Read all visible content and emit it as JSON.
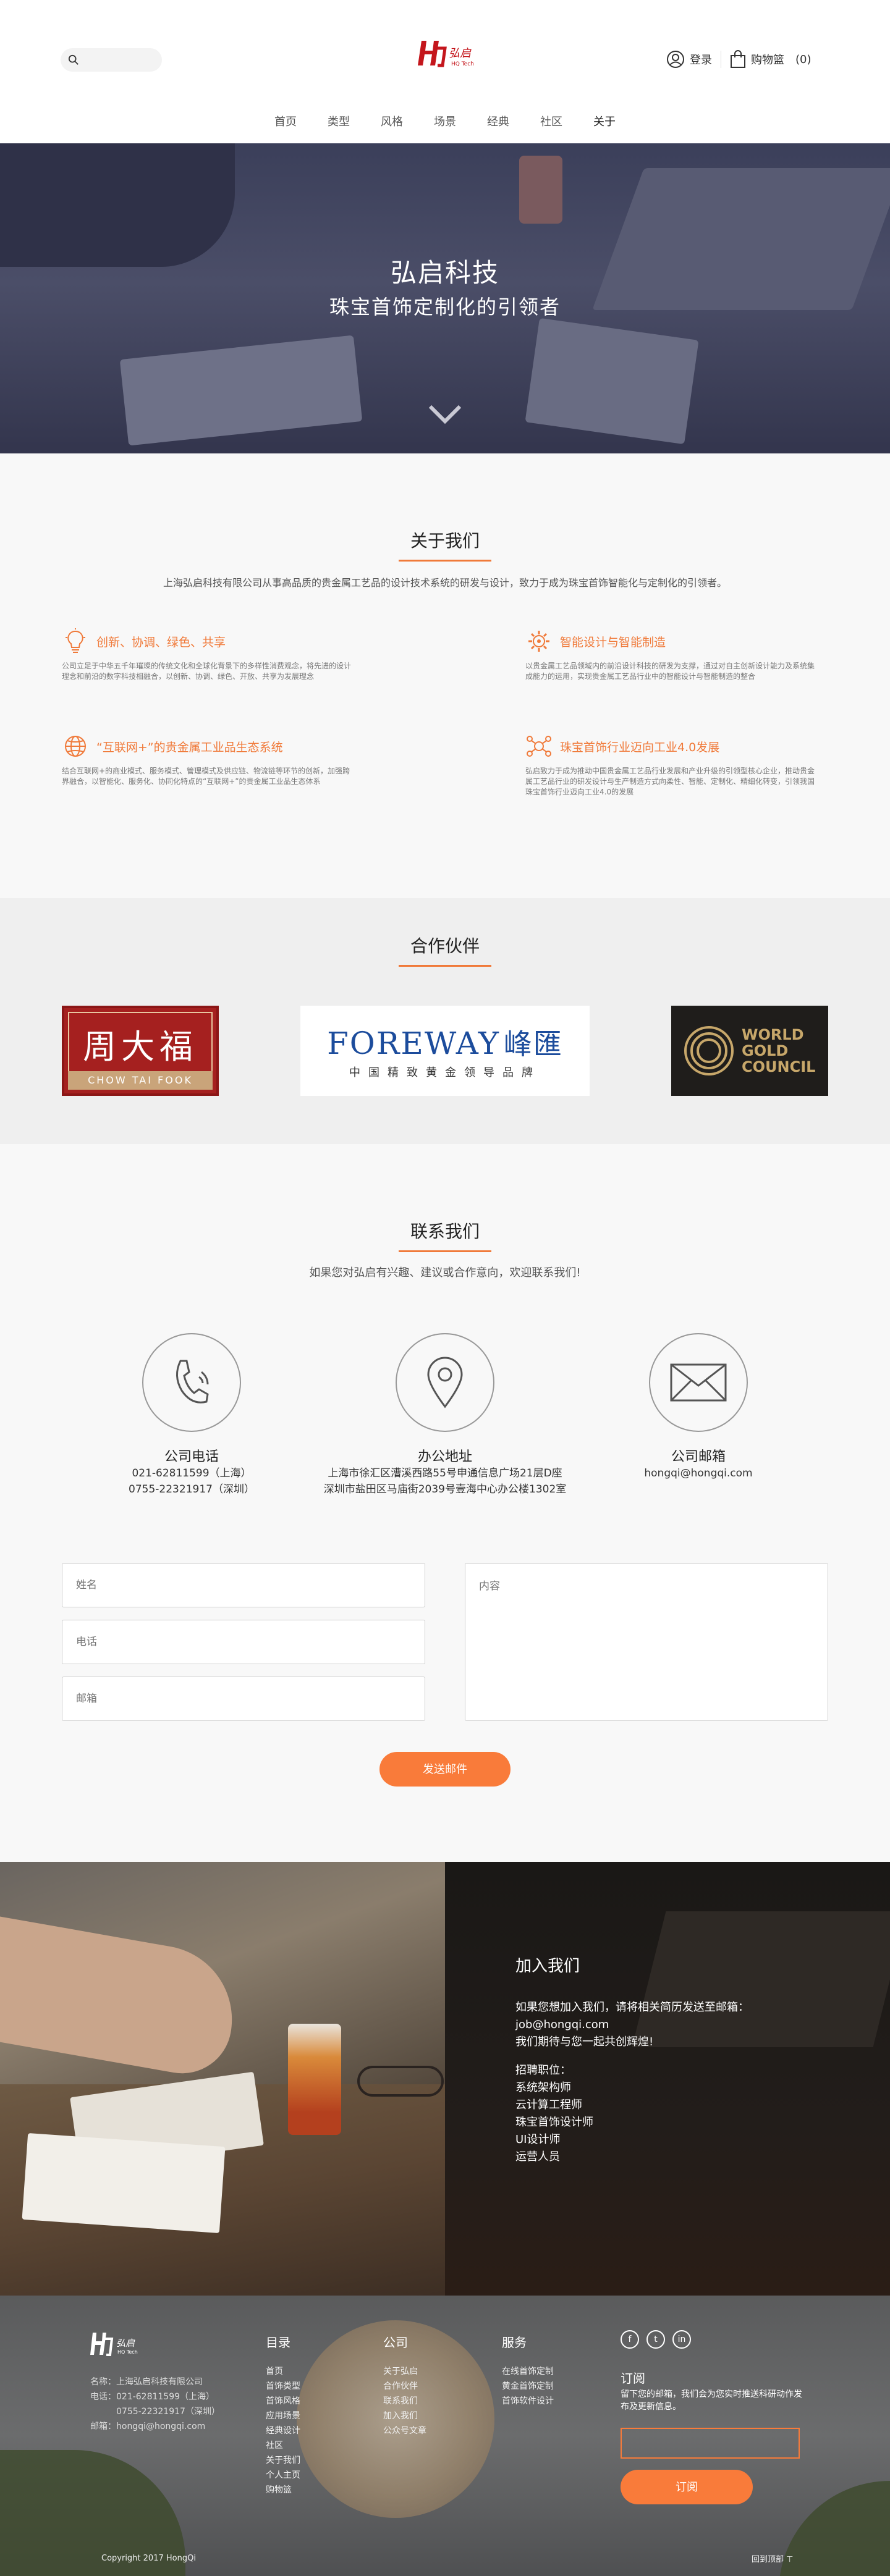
{
  "header": {
    "search_placeholder": "",
    "logo_text": "弘启",
    "logo_sub": "HQ Tech",
    "login_label": "登录",
    "cart_label": "购物篮",
    "cart_count": "(0)"
  },
  "nav": [
    "首页",
    "类型",
    "风格",
    "场景",
    "经典",
    "社区",
    "关于"
  ],
  "nav_active": "关于",
  "hero": {
    "title": "弘启科技",
    "subtitle": "珠宝首饰定制化的引领者"
  },
  "about": {
    "title": "关于我们",
    "desc": "上海弘启科技有限公司从事高品质的贵金属工艺品的设计技术系统的研发与设计，致力于成为珠宝首饰智能化与定制化的引领者。",
    "features": [
      {
        "icon": "lightbulb-icon",
        "title": "创新、协调、绿色、共享",
        "text": "公司立足于中华五千年璀璨的传统文化和全球化背景下的多样性消费观念，将先进的设计理念和前沿的数字科技相融合，以创新、协调、绿色、开放、共享为发展理念"
      },
      {
        "icon": "gear-brain-icon",
        "title": "智能设计与智能制造",
        "text": "以贵金属工艺品领域内的前沿设计科技的研发为支撑，通过对自主创新设计能力及系统集成能力的运用，实现贵金属工艺品行业中的智能设计与智能制造的整合"
      },
      {
        "icon": "globe-icon",
        "title": "“互联网+”的贵金属工业品生态系统",
        "text": "结合互联网+的商业模式、服务模式、管理模式及供应链、物流链等环节的创新，加强跨界融合，以智能化、服务化、协同化特点的“互联网+”的贵金属工业品生态体系"
      },
      {
        "icon": "network-gear-icon",
        "title": "珠宝首饰行业迈向工业4.0发展",
        "text": "弘启致力于成为推动中国贵金属工艺品行业发展和产业升级的引领型核心企业，推动贵金属工艺品行业的研发设计与生产制造方式向柔性、智能、定制化、精细化转变，引领我国珠宝首饰行业迈向工业4.0的发展"
      }
    ]
  },
  "partners": {
    "title": "合作伙伴",
    "items": [
      {
        "name": "周大福",
        "sub": "CHOW TAI FOOK"
      },
      {
        "name": "FOREWAY",
        "name_cn": "峰匯",
        "sub": "中国精致黄金领导品牌"
      },
      {
        "name": "WORLD",
        "name2": "GOLD",
        "name3": "COUNCIL"
      }
    ]
  },
  "contact": {
    "title": "联系我们",
    "desc": "如果您对弘启有兴趣、建议或合作意向，欢迎联系我们!",
    "phone_label": "公司电话",
    "phone_lines": [
      "021-62811599（上海）",
      "0755-22321917（深圳）"
    ],
    "address_label": "办公地址",
    "address_lines": [
      "上海市徐汇区漕溪西路55号申通信息广场21层D座",
      "深圳市盐田区马庙街2039号壹海中心办公楼1302室"
    ],
    "email_label": "公司邮箱",
    "email_lines": [
      "hongqi@hongqi.com"
    ],
    "name_placeholder": "姓名",
    "tel_placeholder": "电话",
    "mail_placeholder": "邮箱",
    "content_placeholder": "内容",
    "send_label": "发送邮件"
  },
  "join": {
    "title": "加入我们",
    "lines": [
      "如果您想加入我们，请将相关简历发送至邮箱：",
      "job@hongqi.com",
      "我们期待与您一起共创辉煌!"
    ],
    "jobs_title": "招聘职位：",
    "jobs": [
      "系统架构师",
      "云计算工程师",
      "珠宝首饰设计师",
      "UI设计师",
      "运营人员"
    ]
  },
  "footer": {
    "info": [
      "名称：上海弘启科技有限公司",
      "电话：021-62811599（上海）",
      "　　　0755-22321917（深圳）",
      "邮箱：hongqi@hongqi.com"
    ],
    "col1": {
      "title": "目录",
      "items": [
        "首页",
        "首饰类型",
        "首饰风格",
        "应用场景",
        "经典设计",
        "社区",
        "关于我们",
        "个人主页",
        "购物篮"
      ]
    },
    "col2": {
      "title": "公司",
      "items": [
        "关于弘启",
        "合作伙伴",
        "联系我们",
        "加入我们",
        "公众号文章"
      ]
    },
    "col3": {
      "title": "服务",
      "items": [
        "在线首饰定制",
        "黄金首饰定制",
        "首饰软件设计"
      ]
    },
    "socials": [
      "f",
      "t",
      "in"
    ],
    "subscribe_title": "订阅",
    "subscribe_text": "留下您的邮箱，我们会为您实时推送科研动作发布及更新信息。",
    "subscribe_btn": "订阅",
    "copyright": "Copyright 2017 HongQi",
    "back_top": "回到顶部 ⊤"
  }
}
